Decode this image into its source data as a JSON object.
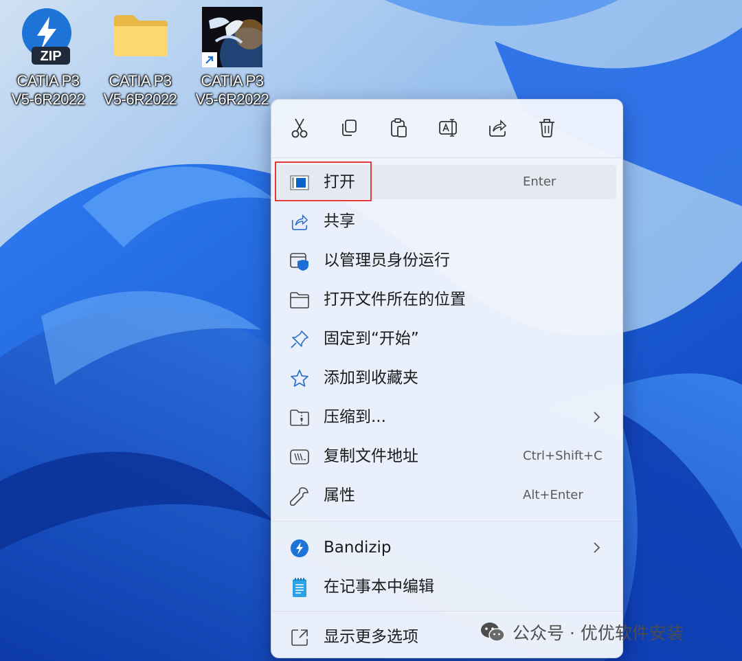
{
  "desktop": {
    "icons": [
      {
        "icon": "bandizip-zip-icon",
        "badge": "ZIP",
        "line1": "CATIA P3",
        "line2": "V5-6R2022"
      },
      {
        "icon": "folder-icon",
        "line1": "CATIA P3",
        "line2": "V5-6R2022"
      },
      {
        "icon": "catia-3ds-icon",
        "line1": "CATIA P3",
        "line2": "V5-6R2022"
      }
    ]
  },
  "context_menu": {
    "toolbar": [
      {
        "name": "cut-icon"
      },
      {
        "name": "copy-icon"
      },
      {
        "name": "paste-icon"
      },
      {
        "name": "rename-icon"
      },
      {
        "name": "share-icon"
      },
      {
        "name": "delete-icon"
      }
    ],
    "items": [
      {
        "label": "打开",
        "shortcut": "Enter",
        "icon": "app-window-icon"
      },
      {
        "label": "共享",
        "icon": "share-icon"
      },
      {
        "label": "以管理员身份运行",
        "icon": "shield-run-icon"
      },
      {
        "label": "打开文件所在的位置",
        "icon": "folder-outline-icon"
      },
      {
        "label": "固定到“开始”",
        "icon": "pin-icon"
      },
      {
        "label": "添加到收藏夹",
        "icon": "star-icon"
      },
      {
        "label": "压缩到...",
        "icon": "zip-folder-icon",
        "submenu": true
      },
      {
        "label": "复制文件地址",
        "shortcut": "Ctrl+Shift+C",
        "icon": "copy-path-icon"
      },
      {
        "label": "属性",
        "shortcut": "Alt+Enter",
        "icon": "wrench-icon"
      },
      {
        "label": "Bandizip",
        "icon": "bandizip-icon",
        "submenu": true
      },
      {
        "label": "在记事本中编辑",
        "icon": "notepad-icon"
      },
      {
        "label": "显示更多选项",
        "icon": "more-options-icon"
      }
    ]
  },
  "watermark": {
    "text": "公众号 · 优优软件安装"
  },
  "colors": {
    "accent": "#0067c0",
    "highlight": "#e0393e",
    "wallpaper": "#1a62e0"
  }
}
